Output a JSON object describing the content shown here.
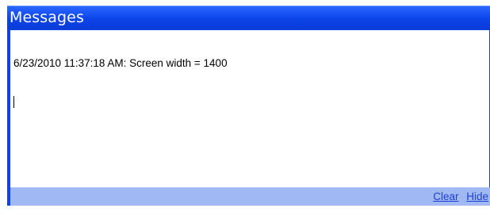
{
  "window": {
    "title": "Messages"
  },
  "log": {
    "lines": [
      "6/23/2010 11:37:18 AM: Screen width = 1400"
    ]
  },
  "footer": {
    "clear_label": "Clear",
    "hide_label": "Hide"
  },
  "colors": {
    "frame": "#0f42e8",
    "footer_background": "#a0b8f4",
    "link": "#1f3fd8"
  }
}
